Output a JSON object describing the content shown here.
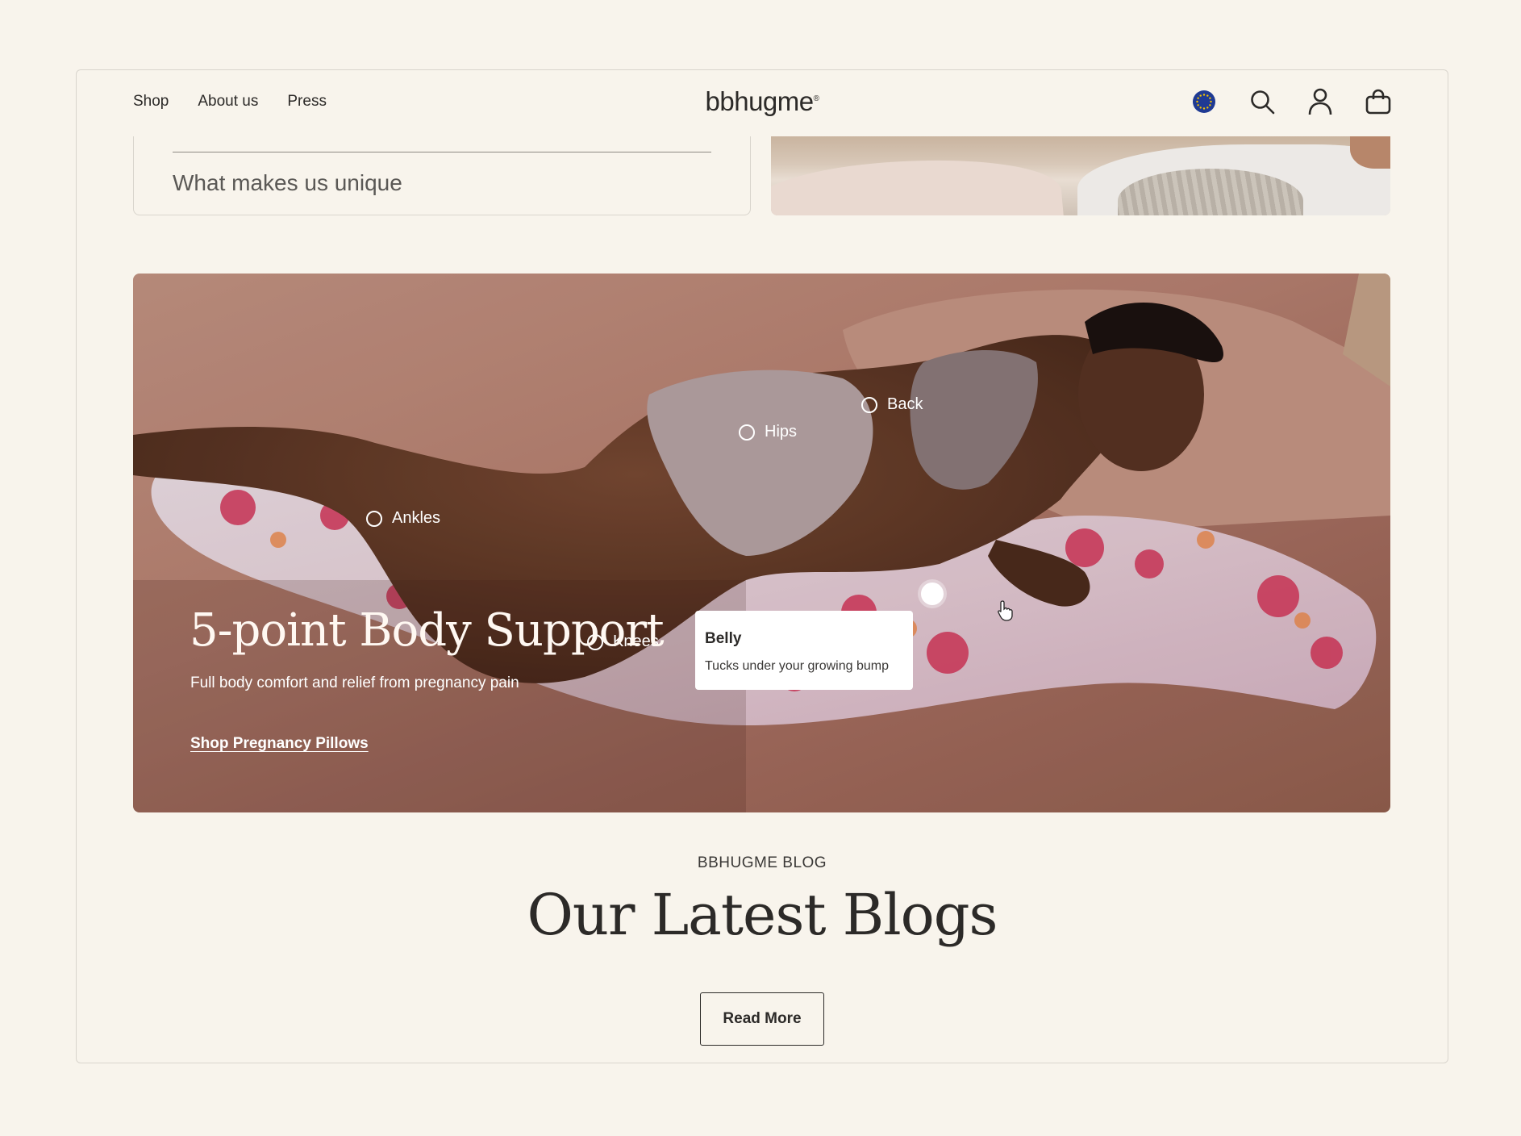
{
  "header": {
    "nav": [
      "Shop",
      "About us",
      "Press"
    ],
    "logo": "bbhugme",
    "logo_mark": "®",
    "icons": [
      "eu-flag-icon",
      "search-icon",
      "account-icon",
      "cart-icon"
    ]
  },
  "top_section": {
    "card_label": "What makes us unique"
  },
  "hero": {
    "title": "5-point Body Support",
    "subtitle": "Full body comfort and relief from pregnancy pain",
    "cta": "Shop Pregnancy Pillows",
    "hotspots": [
      "Back",
      "Hips",
      "Ankles",
      "Knees",
      "Belly"
    ],
    "active_hotspot": "Belly",
    "tooltip": {
      "title": "Belly",
      "body": "Tucks under your growing bump"
    }
  },
  "blog": {
    "eyebrow": "BBHUGME BLOG",
    "title": "Our Latest Blogs",
    "button": "Read More"
  },
  "colors": {
    "background": "#f8f4ec",
    "text": "#2c2a28",
    "eu_blue": "#1f3a93",
    "eu_star": "#f5c400"
  }
}
